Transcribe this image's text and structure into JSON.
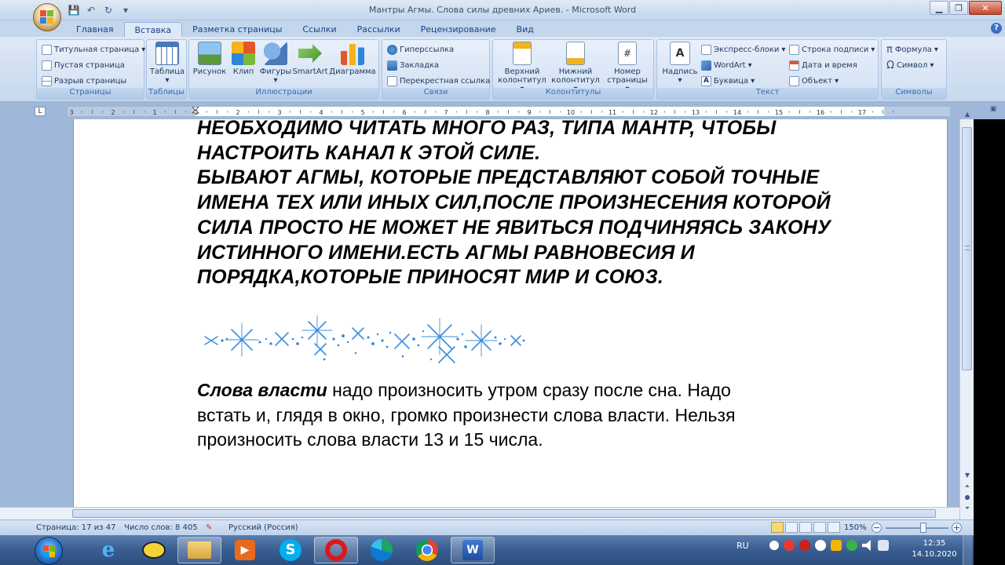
{
  "window": {
    "title": "Мантры Агмы. Слова силы древних Ариев. - Microsoft Word"
  },
  "tabs": [
    "Главная",
    "Вставка",
    "Разметка страницы",
    "Ссылки",
    "Рассылки",
    "Рецензирование",
    "Вид"
  ],
  "ribbon": {
    "pages": {
      "label": "Страницы",
      "items": [
        "Титульная страница",
        "Пустая страница",
        "Разрыв страницы"
      ]
    },
    "tables": {
      "label": "Таблицы",
      "items": [
        "Таблица"
      ]
    },
    "illustrations": {
      "label": "Иллюстрации",
      "items": [
        "Рисунок",
        "Клип",
        "Фигуры",
        "SmartArt",
        "Диаграмма"
      ]
    },
    "links": {
      "label": "Связи",
      "items": [
        "Гиперссылка",
        "Закладка",
        "Перекрестная ссылка"
      ]
    },
    "headers": {
      "label": "Колонтитулы",
      "items": [
        "Верхний колонтитул",
        "Нижний колонтитул",
        "Номер страницы"
      ]
    },
    "text": {
      "label": "Текст",
      "items": [
        "Надпись",
        "Экспресс-блоки",
        "WordArt",
        "Буквица",
        "Строка подписи",
        "Дата и время",
        "Объект"
      ]
    },
    "symbols": {
      "label": "Символы",
      "items": [
        "Формула",
        "Символ"
      ]
    }
  },
  "ruler_numbers": [
    "3",
    "2",
    "1",
    "1",
    "2",
    "3",
    "4",
    "5",
    "6",
    "7",
    "8",
    "9",
    "10",
    "11",
    "12",
    "13",
    "14",
    "15",
    "16",
    "17"
  ],
  "document": {
    "caps_lines": [
      "НЕОБХОДИМО ЧИТАТЬ МНОГО РАЗ, ТИПА МАНТР, ЧТОБЫ",
      "НАСТРОИТЬ КАНАЛ К ЭТОЙ СИЛЕ.",
      "БЫВАЮТ АГМЫ, КОТОРЫЕ ПРЕДСТАВЛЯЮТ СОБОЙ ТОЧНЫЕ",
      "ИМЕНА ТЕХ ИЛИ ИНЫХ СИЛ,ПОСЛЕ ПРОИЗНЕСЕНИЯ КОТОРОЙ",
      "СИЛА ПРОСТО НЕ МОЖЕТ НЕ ЯВИТЬСЯ ПОДЧИНЯЯСЬ ЗАКОНУ",
      "ИСТИННОГО ИМЕНИ.ЕСТЬ АГМЫ РАВНОВЕСИЯ И",
      "ПОРЯДКА,КОТОРЫЕ ПРИНОСЯТ МИР И СОЮЗ."
    ],
    "body_bold": "Слова власти",
    "body_lines": [
      " надо произносить утром сразу после сна. Надо",
      "встать и, глядя в окно, громко произнести слова власти. Нельзя",
      "произносить слова власти 13 и 15 числа."
    ]
  },
  "statusbar": {
    "page": "Страница: 17 из 47",
    "words": "Число слов: 8 405",
    "language": "Русский (Россия)",
    "zoom": "150%"
  },
  "taskbar": {
    "apps": [
      "start-button",
      "internet-explorer",
      "batman-app",
      "file-explorer",
      "media-player",
      "skype",
      "opera",
      "edge",
      "chrome",
      "word"
    ],
    "language": "RU",
    "time": "12:35",
    "date": "14.10.2020"
  }
}
